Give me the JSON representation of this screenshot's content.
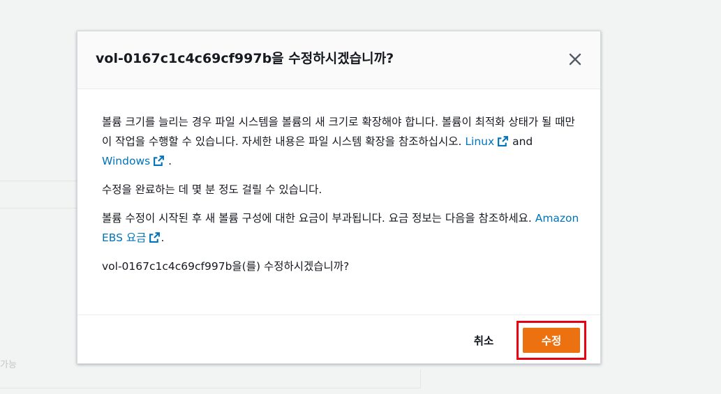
{
  "background": {
    "hint_text": "가능"
  },
  "dialog": {
    "title": "vol-0167c1c4c69cf997b을 수정하시겠습니까?",
    "close_icon": "close-icon",
    "paragraph1": {
      "text": "볼륨 크기를 늘리는 경우 파일 시스템을 볼륨의 새 크기로 확장해야 합니다. 볼륨이 최적화 상태가 될 때만 이 작업을 수행할 수 있습니다. 자세한 내용은 파일 시스템 확장을 참조하십시오. ",
      "link1": "Linux",
      "conj": " and ",
      "link2": "Windows",
      "end": " ."
    },
    "paragraph2": "수정을 완료하는 데 몇 분 정도 걸릴 수 있습니다.",
    "paragraph3": {
      "text": "볼륨 수정이 시작된 후 새 볼륨 구성에 대한 요금이 부과됩니다. 요금 정보는 다음을 참조하세요. ",
      "link": "Amazon EBS 요금",
      "end": "."
    },
    "paragraph4": "vol-0167c1c4c69cf997b을(를) 수정하시겠습니까?",
    "cancel_label": "취소",
    "confirm_label": "수정",
    "colors": {
      "primary": "#ec7211",
      "link": "#0073bb",
      "highlight": "#e60012"
    }
  }
}
